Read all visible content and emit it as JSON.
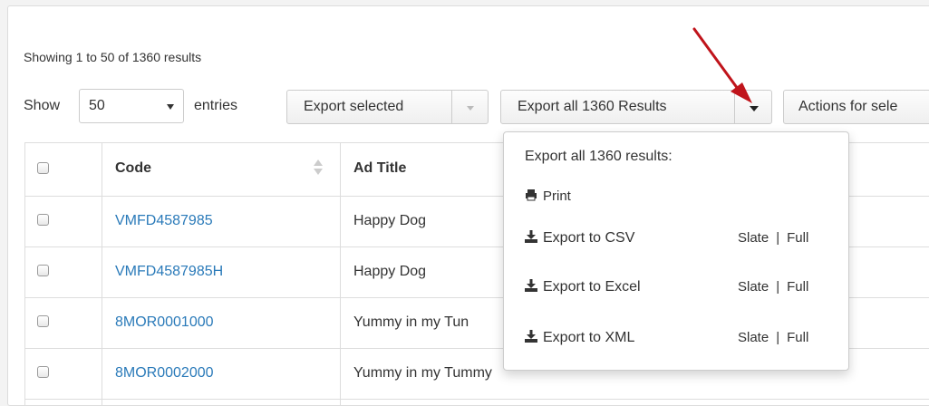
{
  "results_summary": "Showing 1 to 50 of 1360 results",
  "entries": {
    "show_label": "Show",
    "value": "50",
    "suffix": "entries"
  },
  "toolbar": {
    "export_selected": "Export selected",
    "export_all": "Export all 1360 Results",
    "actions": "Actions for sele"
  },
  "table": {
    "headers": {
      "code": "Code",
      "ad_title": "Ad Title"
    },
    "rows": [
      {
        "code": "VMFD4587985",
        "title": "Happy Dog"
      },
      {
        "code": "VMFD4587985H",
        "title": "Happy Dog"
      },
      {
        "code": "8MOR0001000",
        "title": "Yummy in my Tun"
      },
      {
        "code": "8MOR0002000",
        "title": "Yummy in my Tummy"
      }
    ]
  },
  "export_menu": {
    "header": "Export all 1360 results:",
    "print": "Print",
    "csv": "Export to CSV",
    "excel": "Export to Excel",
    "xml": "Export to XML",
    "slate": "Slate",
    "separator": "|",
    "full": "Full"
  },
  "colors": {
    "link": "#2a7ab9",
    "arrow": "#c0141b"
  },
  "icons": {
    "print": "print-icon",
    "download": "download-icon"
  }
}
